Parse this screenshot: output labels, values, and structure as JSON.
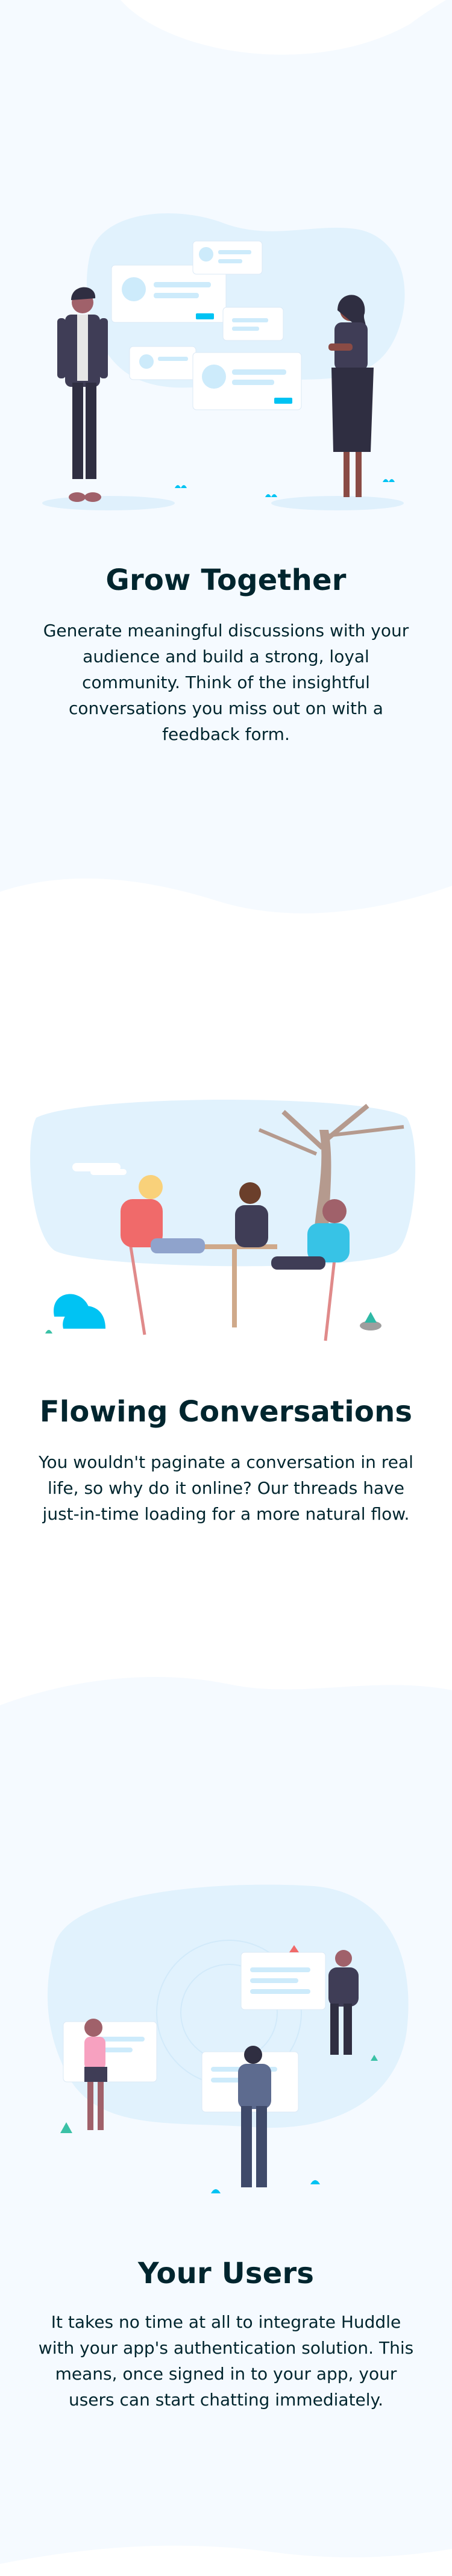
{
  "features": [
    {
      "title": "Grow Together",
      "text": "Generate meaningful discussions with your audience and build a strong, loyal community. Think of the insightful conversations you miss out on with a feedback form.",
      "illustration": "people-with-chat-cards-illustration"
    },
    {
      "title": "Flowing Conversations",
      "text": "You wouldn't paginate a conversation in real life, so why do it online? Our threads have just-in-time loading for a more natural flow.",
      "illustration": "people-talking-at-table-illustration"
    },
    {
      "title": "Your Users",
      "text": "It takes no time at all to integrate Huddle with your app's authentication solution. This means, once signed in to your app, your users can start chatting immediately.",
      "illustration": "users-with-speech-bubbles-illustration"
    }
  ],
  "colors": {
    "section_tint": "#f5faff",
    "blob": "#e1f2fd",
    "heading": "#00252e",
    "accent_cyan": "#00c3f3"
  }
}
